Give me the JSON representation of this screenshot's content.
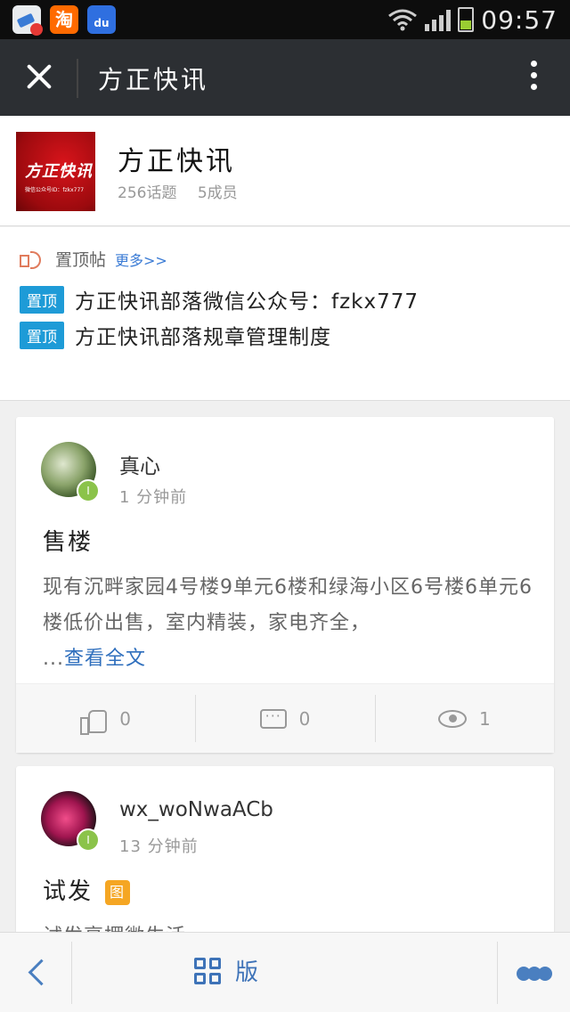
{
  "status_bar": {
    "time": "09:57"
  },
  "header": {
    "title": "方正快讯"
  },
  "group": {
    "name": "方正快讯",
    "topics": "256话题",
    "members": "5成员",
    "logo_text": "方正快讯",
    "logo_subtext": "微信公众号ID：fzkx777"
  },
  "pinned": {
    "label": "置顶帖",
    "more": "更多>>",
    "items": [
      {
        "tag": "置顶",
        "text": "方正快讯部落微信公众号：fzkx777"
      },
      {
        "tag": "置顶",
        "text": "方正快讯部落规章管理制度"
      }
    ]
  },
  "posts": [
    {
      "author": "真心",
      "time": "1 分钟前",
      "title": "售楼",
      "body": "现有沉畔家园4号楼9单元6楼和绿海小区6号楼6单元6楼低价出售，室内精装，家电齐全，",
      "ellipsis": "...",
      "read_more": "查看全文",
      "likes": "0",
      "comments": "0",
      "views": "1",
      "level": "I"
    },
    {
      "author": "wx_woNwaACb",
      "time": "13 分钟前",
      "title": "试发",
      "title_badge": "图",
      "body": "试发享摆微生活",
      "level": "I"
    }
  ],
  "bottom_bar": {
    "layout_label": "版"
  },
  "colors": {
    "accent": "#3e73b8",
    "pin_tag": "#1e9bd7",
    "title_bar": "#2c2f33",
    "level_badge": "#8bc34a"
  }
}
